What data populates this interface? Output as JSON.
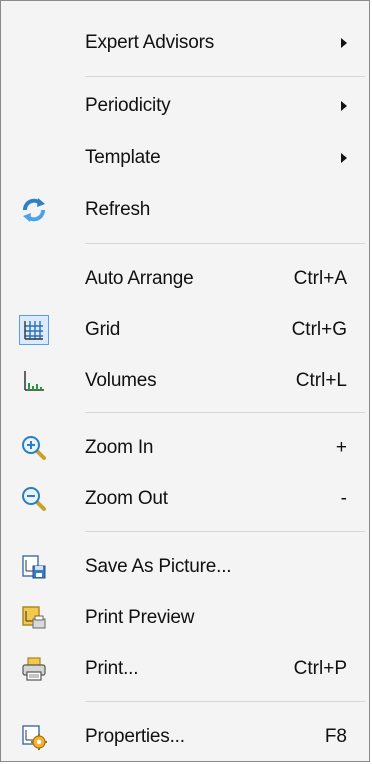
{
  "menu": {
    "expert_advisors": {
      "label": "Expert Advisors",
      "submenu": true
    },
    "periodicity": {
      "label": "Periodicity",
      "submenu": true
    },
    "template": {
      "label": "Template",
      "submenu": true
    },
    "refresh": {
      "label": "Refresh",
      "icon": "refresh-icon"
    },
    "auto_arrange": {
      "label": "Auto Arrange",
      "shortcut": "Ctrl+A"
    },
    "grid": {
      "label": "Grid",
      "shortcut": "Ctrl+G",
      "icon": "grid-icon",
      "checked": true
    },
    "volumes": {
      "label": "Volumes",
      "shortcut": "Ctrl+L",
      "icon": "volumes-icon"
    },
    "zoom_in": {
      "label": "Zoom In",
      "shortcut": "+",
      "icon": "zoom-in-icon"
    },
    "zoom_out": {
      "label": "Zoom Out",
      "shortcut": "-",
      "icon": "zoom-out-icon"
    },
    "save_as_picture": {
      "label": "Save As Picture...",
      "icon": "save-picture-icon"
    },
    "print_preview": {
      "label": "Print Preview",
      "icon": "print-preview-icon"
    },
    "print": {
      "label": "Print...",
      "shortcut": "Ctrl+P",
      "icon": "printer-icon"
    },
    "properties": {
      "label": "Properties...",
      "shortcut": "F8",
      "icon": "properties-icon"
    }
  },
  "colors": {
    "background": "#f4f4f4",
    "border": "#8a8a8a",
    "separator": "#d6d6d6",
    "checked_highlight": "#dbeafc",
    "checked_border": "#5a9ee0"
  }
}
